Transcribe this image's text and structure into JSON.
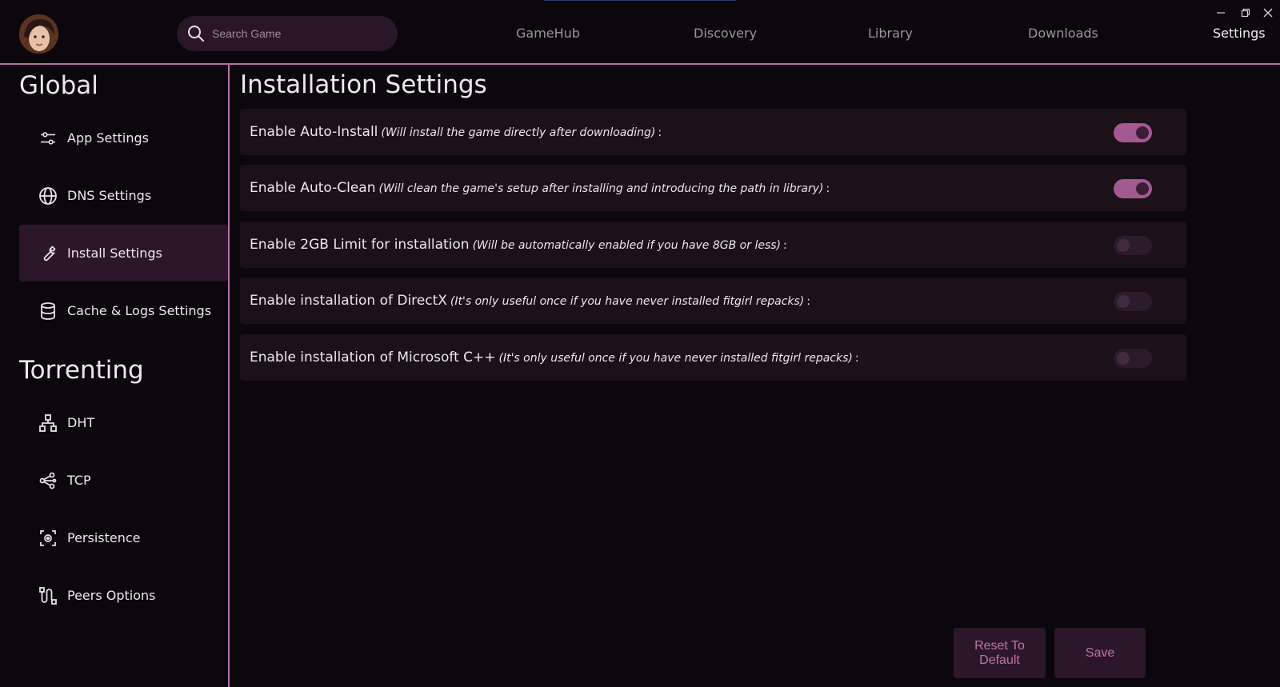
{
  "header": {
    "search_placeholder": "Search Game",
    "nav": [
      {
        "label": "GameHub",
        "active": false
      },
      {
        "label": "Discovery",
        "active": false
      },
      {
        "label": "Library",
        "active": false
      },
      {
        "label": "Downloads",
        "active": false
      },
      {
        "label": "Settings",
        "active": true
      }
    ],
    "window_controls": [
      "minimize-icon",
      "restore-icon",
      "close-icon"
    ]
  },
  "sidebar": {
    "global_title": "Global",
    "global_items": [
      {
        "label": "App Settings",
        "icon": "sliders-icon",
        "active": false
      },
      {
        "label": "DNS Settings",
        "icon": "globe-icon",
        "active": false
      },
      {
        "label": "Install Settings",
        "icon": "wrench-icon",
        "active": true
      },
      {
        "label": "Cache & Logs Settings",
        "icon": "database-icon",
        "active": false
      }
    ],
    "torrenting_title": "Torrenting",
    "torrenting_items": [
      {
        "label": "DHT",
        "icon": "network-icon"
      },
      {
        "label": "TCP",
        "icon": "route-icon"
      },
      {
        "label": "Persistence",
        "icon": "save-settings-icon"
      },
      {
        "label": "Peers Options",
        "icon": "peers-route-icon"
      }
    ]
  },
  "main": {
    "title": "Installation Settings",
    "settings": [
      {
        "label": "Enable Auto-Install",
        "note": "(Will install the game directly after downloading)",
        "suffix": ":",
        "enabled": true
      },
      {
        "label": "Enable Auto-Clean",
        "note": "(Will clean the game's setup after installing and introducing the path in library)",
        "suffix": ":",
        "enabled": true
      },
      {
        "label": "Enable 2GB Limit for installation",
        "note": "(Will be automatically enabled if you have 8GB or less)",
        "suffix": ":",
        "enabled": false
      },
      {
        "label": "Enable installation of DirectX",
        "note": "(It's only useful once if you have never installed fitgirl repacks)",
        "suffix": ":",
        "enabled": false
      },
      {
        "label": "Enable installation of Microsoft C++",
        "note": "(It's only useful once if you have never installed fitgirl repacks)",
        "suffix": ":",
        "enabled": false
      }
    ],
    "reset_label": "Reset To Default",
    "save_label": "Save"
  },
  "colors": {
    "accent": "#b86ea8",
    "toggle_on": "#a35a93",
    "panel": "#1c1019",
    "background": "#0b070d"
  }
}
